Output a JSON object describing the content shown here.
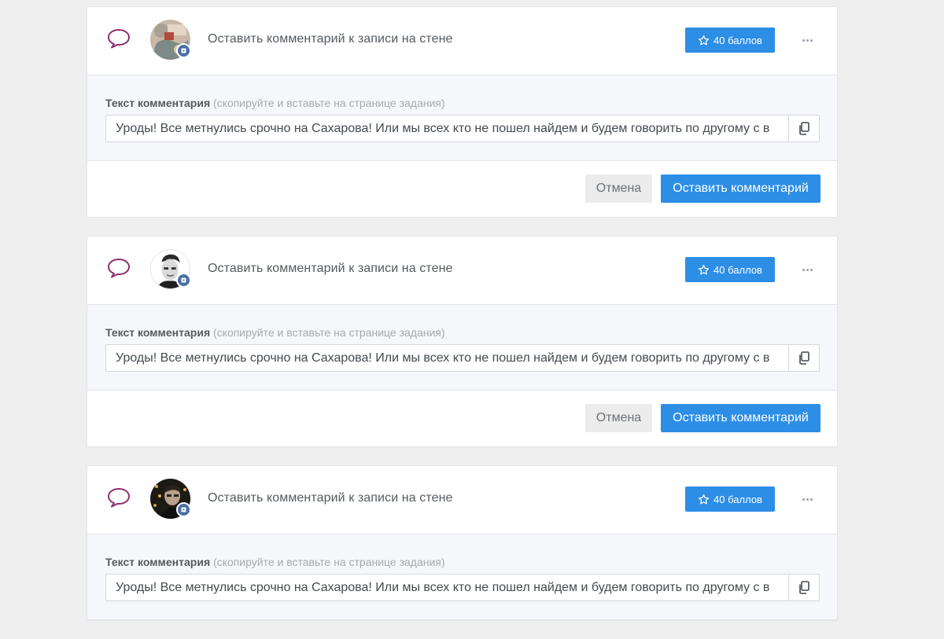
{
  "colors": {
    "accent": "#2d8ee6",
    "task_icon": "#8b2f6e",
    "vk_badge": "#4a6fa5",
    "page_bg": "#f0efef"
  },
  "tasks": [
    {
      "type_icon": "comment-bubble-icon",
      "title": "Оставить комментарий к записи на стене",
      "points_label": "40 баллов",
      "field_label": "Текст комментария",
      "field_hint": "(скопируйте и вставьте на странице задания)",
      "comment_text": "Уроды! Все метнулись срочно на Сахарова! Или мы всех кто не пошел найдем и будем говорить по другому с в",
      "cancel_label": "Отмена",
      "submit_label": "Оставить комментарий"
    },
    {
      "type_icon": "comment-bubble-icon",
      "title": "Оставить комментарий к записи на стене",
      "points_label": "40 баллов",
      "field_label": "Текст комментария",
      "field_hint": "(скопируйте и вставьте на странице задания)",
      "comment_text": "Уроды! Все метнулись срочно на Сахарова! Или мы всех кто не пошел найдем и будем говорить по другому с в",
      "cancel_label": "Отмена",
      "submit_label": "Оставить комментарий"
    },
    {
      "type_icon": "comment-bubble-icon",
      "title": "Оставить комментарий к записи на стене",
      "points_label": "40 баллов",
      "field_label": "Текст комментария",
      "field_hint": "(скопируйте и вставьте на странице задания)",
      "comment_text": "Уроды! Все метнулись срочно на Сахарова! Или мы всех кто не пошел найдем и будем говорить по другому с в"
    }
  ]
}
